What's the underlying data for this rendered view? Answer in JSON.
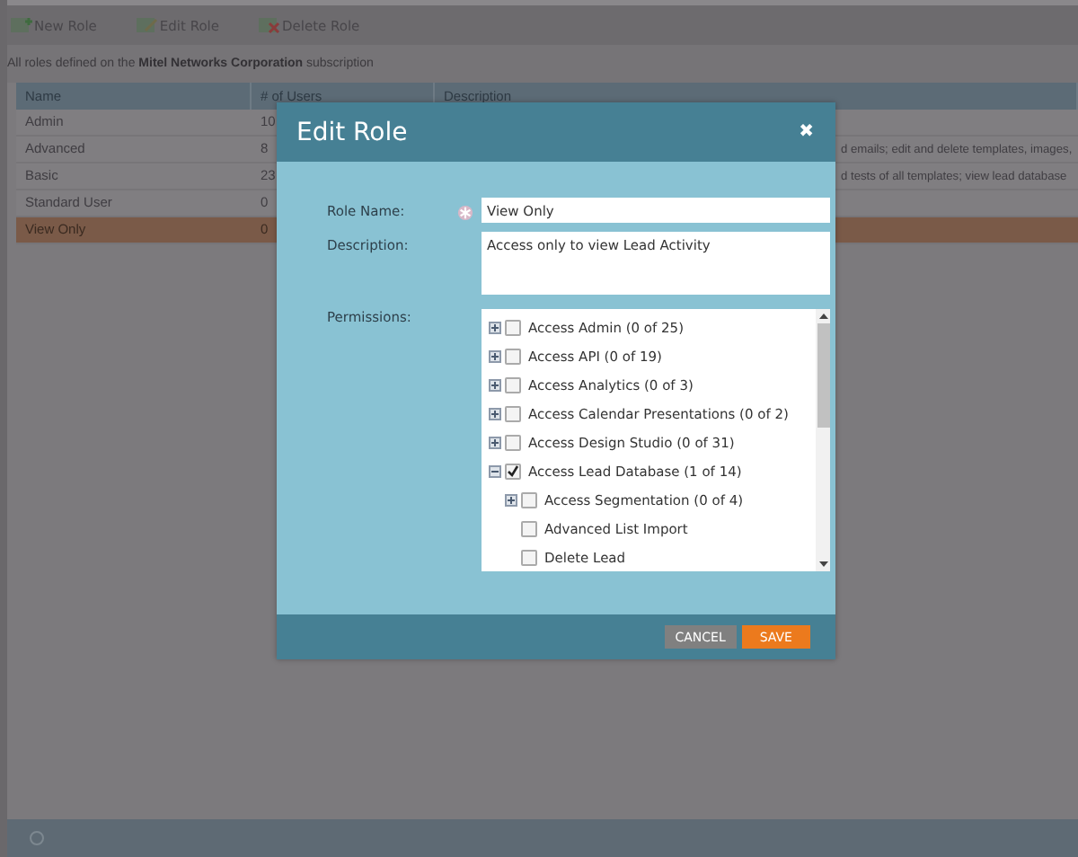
{
  "toolbar": {
    "buttons": [
      "New Role",
      "Edit Role",
      "Delete Role"
    ]
  },
  "subtitle": {
    "before": "All roles defined on the",
    "company": "Mitel Networks Corporation",
    "after": "subscription"
  },
  "table": {
    "columns": [
      "Name",
      "# of Users",
      "Description"
    ],
    "rows": [
      {
        "name": "Admin",
        "users": "10",
        "description": "",
        "selected": false
      },
      {
        "name": "Advanced",
        "users": "8",
        "description": "d emails; edit and delete templates, images,",
        "selected": false
      },
      {
        "name": "Basic",
        "users": "23",
        "description": "d tests of all templates; view lead database",
        "selected": false
      },
      {
        "name": "Standard User",
        "users": "0",
        "description": "",
        "selected": false
      },
      {
        "name": "View Only",
        "users": "0",
        "description": "",
        "selected": true
      }
    ]
  },
  "dialog": {
    "title": "Edit Role",
    "close": "✖",
    "role_name": {
      "label": "Role Name:",
      "value": "View Only",
      "required": true
    },
    "description": {
      "label": "Description:",
      "value": "Access only to view Lead Activity"
    },
    "permissions": {
      "label": "Permissions:",
      "items": [
        {
          "label": "Access Admin (0 of 25)",
          "checked": false,
          "expanded": false
        },
        {
          "label": "Access API (0 of 19)",
          "checked": false,
          "expanded": false
        },
        {
          "label": "Access Analytics (0 of 3)",
          "checked": false,
          "expanded": false
        },
        {
          "label": "Access Calendar Presentations (0 of 2)",
          "checked": false,
          "expanded": false
        },
        {
          "label": "Access Design Studio (0 of 31)",
          "checked": false,
          "expanded": false
        },
        {
          "label": "Access Lead Database (1 of 14)",
          "checked": true,
          "expanded": true,
          "children": [
            {
              "label": "Access Segmentation (0 of 4)",
              "checked": false,
              "expanded": false
            },
            {
              "label": "Advanced List Import",
              "checked": false
            },
            {
              "label": "Delete Lead",
              "checked": false
            }
          ]
        }
      ]
    },
    "buttons": [
      "CANCEL",
      "SAVE"
    ]
  }
}
